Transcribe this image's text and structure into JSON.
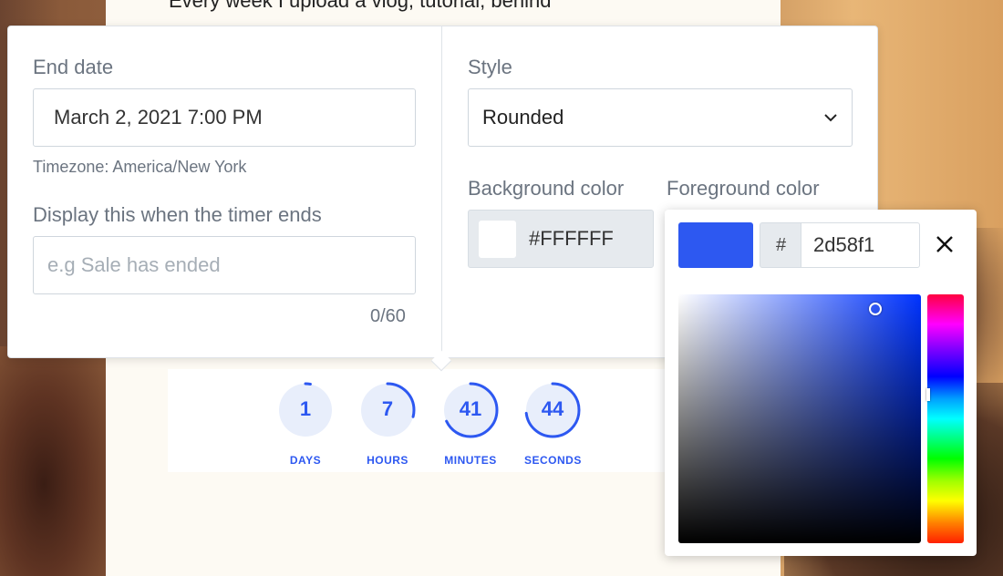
{
  "background": {
    "page_text": "Every week I upload a vlog, tutorial, behind"
  },
  "timer": {
    "accent_color": "#2d58f1",
    "units": [
      {
        "value": "1",
        "label": "DAYS",
        "progress": 0.03
      },
      {
        "value": "7",
        "label": "HOURS",
        "progress": 0.29
      },
      {
        "value": "41",
        "label": "MINUTES",
        "progress": 0.68
      },
      {
        "value": "44",
        "label": "SECONDS",
        "progress": 0.73
      }
    ]
  },
  "settings": {
    "end_date": {
      "label": "End date",
      "value": "March 2, 2021 7:00 PM",
      "timezone": "Timezone: America/New York"
    },
    "end_message": {
      "label": "Display this when the timer ends",
      "placeholder": "e.g Sale has ended",
      "counter": "0/60"
    },
    "style": {
      "label": "Style",
      "selected": "Rounded"
    },
    "background_color": {
      "label": "Background color",
      "value": "#FFFFFF"
    },
    "foreground_color": {
      "label": "Foreground color"
    }
  },
  "color_picker": {
    "hash": "#",
    "hex_value": "2d58f1",
    "swatch_color": "#2d58f1",
    "close_icon": "close-icon"
  }
}
